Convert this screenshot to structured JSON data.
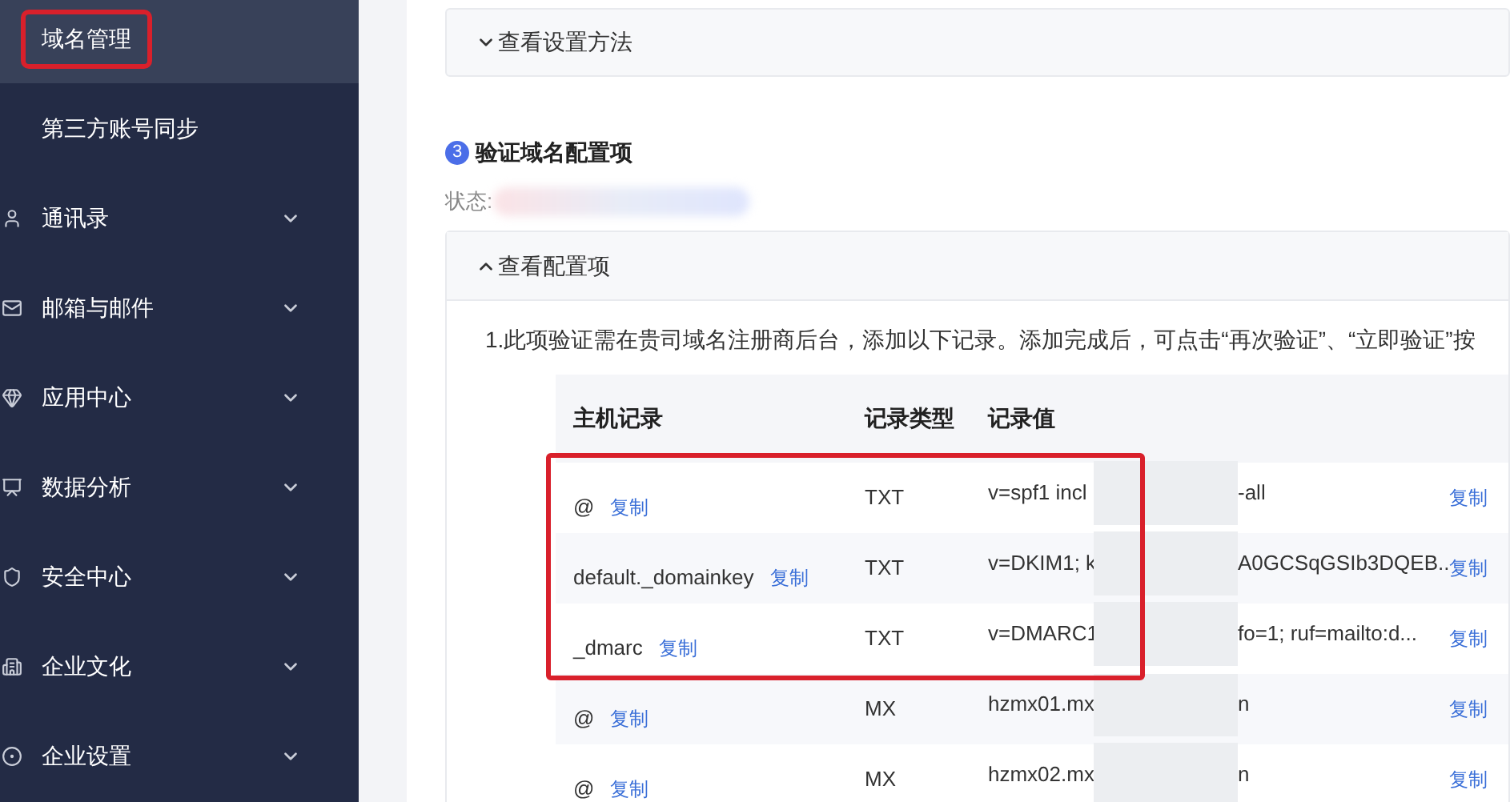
{
  "sidebar": {
    "items": [
      {
        "label": "域名管理",
        "selected": true,
        "highlighted": true,
        "expandable": false
      },
      {
        "label": "第三方账号同步",
        "selected": false,
        "highlighted": false,
        "expandable": false
      },
      {
        "label": "通讯录",
        "selected": false,
        "highlighted": false,
        "expandable": true
      },
      {
        "label": "邮箱与邮件",
        "selected": false,
        "highlighted": false,
        "expandable": true
      },
      {
        "label": "应用中心",
        "selected": false,
        "highlighted": false,
        "expandable": true
      },
      {
        "label": "数据分析",
        "selected": false,
        "highlighted": false,
        "expandable": true
      },
      {
        "label": "安全中心",
        "selected": false,
        "highlighted": false,
        "expandable": true
      },
      {
        "label": "企业文化",
        "selected": false,
        "highlighted": false,
        "expandable": true
      },
      {
        "label": "企业设置",
        "selected": false,
        "highlighted": false,
        "expandable": true
      }
    ]
  },
  "setup_panel": {
    "title": "查看设置方法",
    "expanded": false
  },
  "step": {
    "number": "3",
    "title": "验证域名配置项"
  },
  "status": {
    "label": "状态:"
  },
  "config_panel": {
    "title": "查看配置项",
    "expanded": true,
    "instruction": "1.此项验证需在贵司域名注册商后台，添加以下记录。添加完成后，可点击“再次验证”、“立即验证”按",
    "table": {
      "columns": [
        "主机记录",
        "记录类型",
        "记录值"
      ],
      "rows": [
        {
          "host": "@",
          "copy_host": "复制",
          "type": "TXT",
          "value_start": "v=spf1 incl",
          "value_end": "-all",
          "copy_value": "复制",
          "highlighted": true
        },
        {
          "host": "default._domainkey",
          "copy_host": "复制",
          "type": "TXT",
          "value_start": "v=DKIM1; k",
          "value_end": "A0GCSqGSIb3DQEB...",
          "copy_value": "复制",
          "highlighted": true
        },
        {
          "host": "_dmarc",
          "copy_host": "复制",
          "type": "TXT",
          "value_start": "v=DMARC1",
          "value_end": "fo=1; ruf=mailto:d...",
          "copy_value": "复制",
          "highlighted": true
        },
        {
          "host": "@",
          "copy_host": "复制",
          "type": "MX",
          "value_start": "hzmx01.mx",
          "value_end": "n",
          "copy_value": "复制",
          "highlighted": false
        },
        {
          "host": "@",
          "copy_host": "复制",
          "type": "MX",
          "value_start": "hzmx02.mx",
          "value_end": "n",
          "copy_value": "复制",
          "highlighted": false
        }
      ]
    }
  }
}
